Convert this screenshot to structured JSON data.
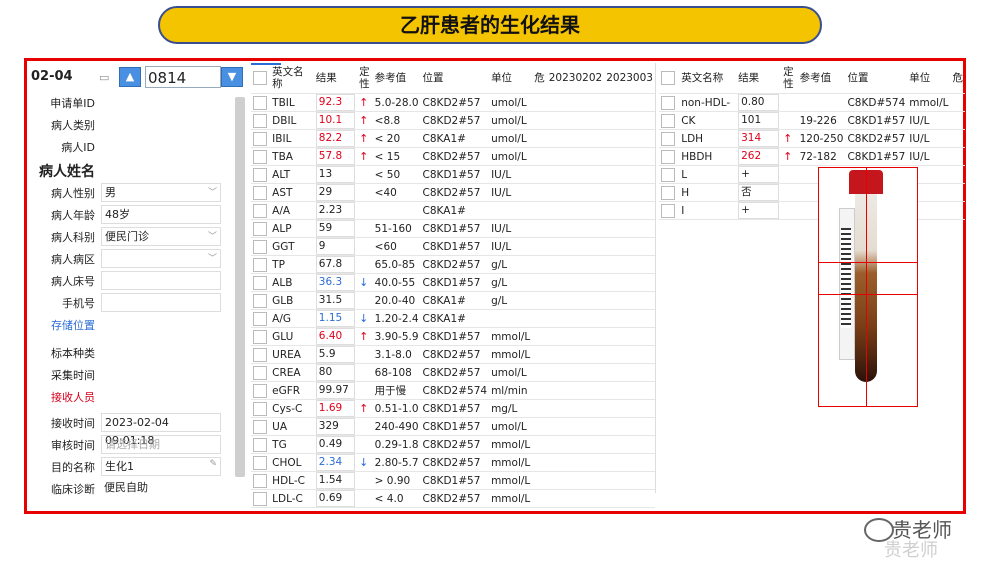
{
  "slide": {
    "title": "乙肝患者的生化结果"
  },
  "left_panel": {
    "date": "02-04",
    "sample_number": "0814",
    "fields": [
      {
        "label": "申请单ID",
        "value": ""
      },
      {
        "label": "病人类别",
        "value": ""
      },
      {
        "label": "病人ID",
        "value": ""
      },
      {
        "label": "病人姓名",
        "value": ""
      },
      {
        "label": "病人性别",
        "value": "男"
      },
      {
        "label": "病人年龄",
        "value": "48岁"
      },
      {
        "label": "病人科别",
        "value": "便民门诊"
      },
      {
        "label": "病人病区",
        "value": ""
      },
      {
        "label": "病人床号",
        "value": ""
      },
      {
        "label": "手机号",
        "value": ""
      },
      {
        "label": "存储位置",
        "value": ""
      },
      {
        "label": "标本种类",
        "value": ""
      },
      {
        "label": "采集时间",
        "value": ""
      },
      {
        "label": "接收人员",
        "value": ""
      },
      {
        "label": "接收时间",
        "value": "2023-02-04 09:01:18"
      },
      {
        "label": "审核时间",
        "value": "",
        "placeholder": "请选择日期"
      },
      {
        "label": "目的名称",
        "value": "生化1"
      },
      {
        "label": "临床诊断",
        "value": "便民自助"
      }
    ]
  },
  "middle_table": {
    "headers": [
      "英文名称",
      "结果",
      "定性",
      "参考值",
      "位置",
      "单位",
      "危",
      "20230202",
      "2023003"
    ],
    "rows": [
      {
        "name": "TBIL",
        "result": "92.3",
        "flag": "up",
        "ref": "5.0-28.0",
        "pos": "C8KD2#57",
        "unit": "umol/L"
      },
      {
        "name": "DBIL",
        "result": "10.1",
        "flag": "up",
        "ref": "<8.8",
        "pos": "C8KD2#57",
        "unit": "umol/L"
      },
      {
        "name": "IBIL",
        "result": "82.2",
        "flag": "up",
        "ref": "< 20",
        "pos": "C8KA1#",
        "unit": "umol/L"
      },
      {
        "name": "TBA",
        "result": "57.8",
        "flag": "up",
        "ref": "< 15",
        "pos": "C8KD2#57",
        "unit": "umol/L"
      },
      {
        "name": "ALT",
        "result": "13",
        "flag": "",
        "ref": "< 50",
        "pos": "C8KD1#57",
        "unit": "IU/L"
      },
      {
        "name": "AST",
        "result": "29",
        "flag": "",
        "ref": "<40",
        "pos": "C8KD2#57",
        "unit": "IU/L"
      },
      {
        "name": "A/A",
        "result": "2.23",
        "flag": "",
        "ref": "",
        "pos": "C8KA1#",
        "unit": ""
      },
      {
        "name": "ALP",
        "result": "59",
        "flag": "",
        "ref": "51-160",
        "pos": "C8KD1#57",
        "unit": "IU/L"
      },
      {
        "name": "GGT",
        "result": "9",
        "flag": "",
        "ref": "<60",
        "pos": "C8KD1#57",
        "unit": "IU/L"
      },
      {
        "name": "TP",
        "result": "67.8",
        "flag": "",
        "ref": "65.0-85",
        "pos": "C8KD2#57",
        "unit": "g/L"
      },
      {
        "name": "ALB",
        "result": "36.3",
        "flag": "down",
        "ref": "40.0-55",
        "pos": "C8KD1#57",
        "unit": "g/L"
      },
      {
        "name": "GLB",
        "result": "31.5",
        "flag": "",
        "ref": "20.0-40",
        "pos": "C8KA1#",
        "unit": "g/L"
      },
      {
        "name": "A/G",
        "result": "1.15",
        "flag": "down",
        "ref": "1.20-2.4",
        "pos": "C8KA1#",
        "unit": ""
      },
      {
        "name": "GLU",
        "result": "6.40",
        "flag": "up",
        "ref": "3.90-5.9",
        "pos": "C8KD1#57",
        "unit": "mmol/L"
      },
      {
        "name": "UREA",
        "result": "5.9",
        "flag": "",
        "ref": "3.1-8.0",
        "pos": "C8KD2#57",
        "unit": "mmol/L"
      },
      {
        "name": "CREA",
        "result": "80",
        "flag": "",
        "ref": "68-108",
        "pos": "C8KD2#57",
        "unit": "umol/L"
      },
      {
        "name": "eGFR",
        "result": "99.97",
        "flag": "",
        "ref": "用于慢",
        "pos": "C8KD2#574",
        "unit": "ml/min"
      },
      {
        "name": "Cys-C",
        "result": "1.69",
        "flag": "up",
        "ref": "0.51-1.0",
        "pos": "C8KD1#57",
        "unit": "mg/L"
      },
      {
        "name": "UA",
        "result": "329",
        "flag": "",
        "ref": "240-490",
        "pos": "C8KD1#57",
        "unit": "umol/L"
      },
      {
        "name": "TG",
        "result": "0.49",
        "flag": "",
        "ref": "0.29-1.8",
        "pos": "C8KD2#57",
        "unit": "mmol/L"
      },
      {
        "name": "CHOL",
        "result": "2.34",
        "flag": "down",
        "ref": "2.80-5.7",
        "pos": "C8KD2#57",
        "unit": "mmol/L"
      },
      {
        "name": "HDL-C",
        "result": "1.54",
        "flag": "",
        "ref": "> 0.90",
        "pos": "C8KD1#57",
        "unit": "mmol/L"
      },
      {
        "name": "LDL-C",
        "result": "0.69",
        "flag": "",
        "ref": "< 4.0",
        "pos": "C8KD2#57",
        "unit": "mmol/L"
      }
    ]
  },
  "right_table": {
    "headers": [
      "英文名称",
      "结果",
      "定性",
      "参考值",
      "位置",
      "单位",
      "危"
    ],
    "rows": [
      {
        "name": "non-HDL-",
        "result": "0.80",
        "flag": "",
        "ref": "",
        "pos": "C8KD#574",
        "unit": "mmol/L"
      },
      {
        "name": "CK",
        "result": "101",
        "flag": "",
        "ref": "19-226",
        "pos": "C8KD1#57",
        "unit": "IU/L"
      },
      {
        "name": "LDH",
        "result": "314",
        "flag": "up",
        "ref": "120-250",
        "pos": "C8KD2#57",
        "unit": "IU/L"
      },
      {
        "name": "HBDH",
        "result": "262",
        "flag": "up",
        "ref": "72-182",
        "pos": "C8KD1#57",
        "unit": "IU/L"
      },
      {
        "name": "L",
        "result": "+",
        "flag": "",
        "ref": "",
        "pos": "",
        "unit": ""
      },
      {
        "name": "H",
        "result": "否",
        "flag": "",
        "ref": "",
        "pos": "",
        "unit": ""
      },
      {
        "name": "I",
        "result": "+",
        "flag": "",
        "ref": "",
        "pos": "",
        "unit": ""
      }
    ]
  },
  "watermark": {
    "text": "贵老师",
    "shadow_text": "贵老师"
  },
  "icons": {
    "calendar": "calendar-icon",
    "up": "chevron-up-icon",
    "down": "chevron-down-icon",
    "flag_up": "arrow-up-icon",
    "flag_down": "arrow-down-icon",
    "tube": "blood-tube-image"
  },
  "colors": {
    "frame": "#e60000",
    "title_bg": "#f5c400",
    "abnormal_high": "#e0001a",
    "abnormal_low": "#2b6cd4"
  }
}
